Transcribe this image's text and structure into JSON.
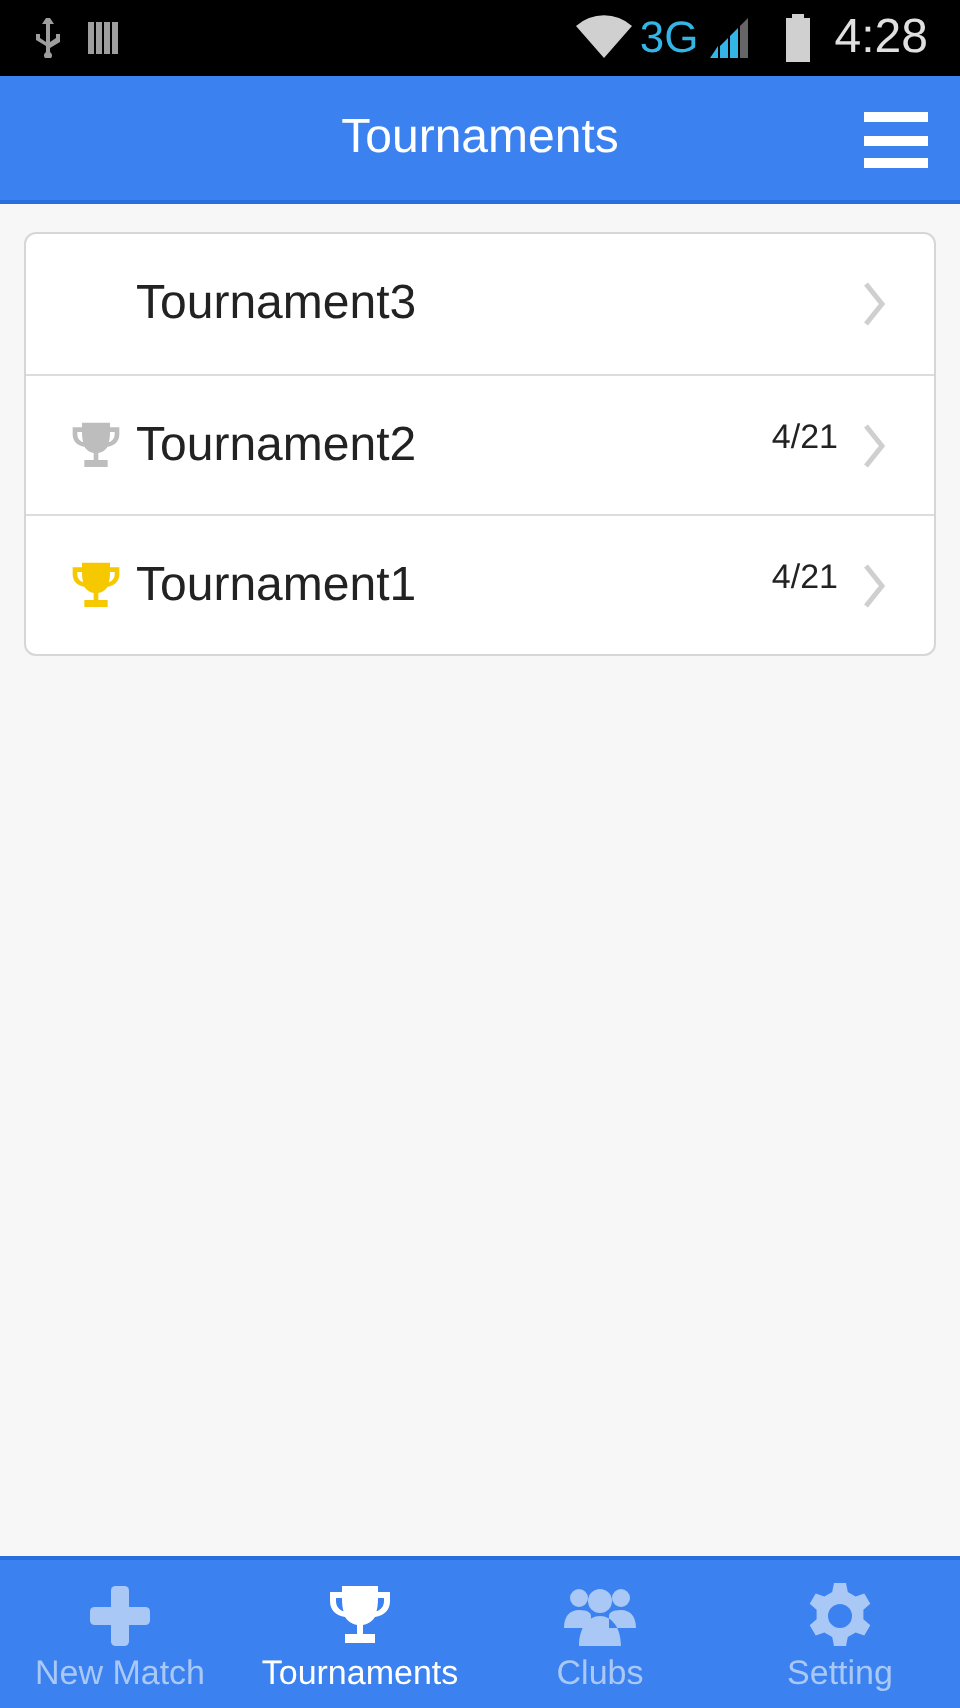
{
  "status_bar": {
    "network": "3G",
    "time": "4:28"
  },
  "header": {
    "title": "Tournaments"
  },
  "tournaments": [
    {
      "name": "Tournament3",
      "kind": "plain"
    },
    {
      "name": "Tournament2",
      "kind": "trophy",
      "color": "#bdbdbd",
      "date": "4/21"
    },
    {
      "name": "Tournament1",
      "kind": "trophy",
      "color": "#f5c800",
      "date": "4/21"
    }
  ],
  "tabs": [
    {
      "label": "New Match",
      "kind": "plus",
      "selected": false
    },
    {
      "label": "Tournaments",
      "kind": "trophy",
      "selected": true
    },
    {
      "label": "Clubs",
      "kind": "group",
      "selected": false
    },
    {
      "label": "Setting",
      "kind": "gear",
      "selected": false
    }
  ]
}
